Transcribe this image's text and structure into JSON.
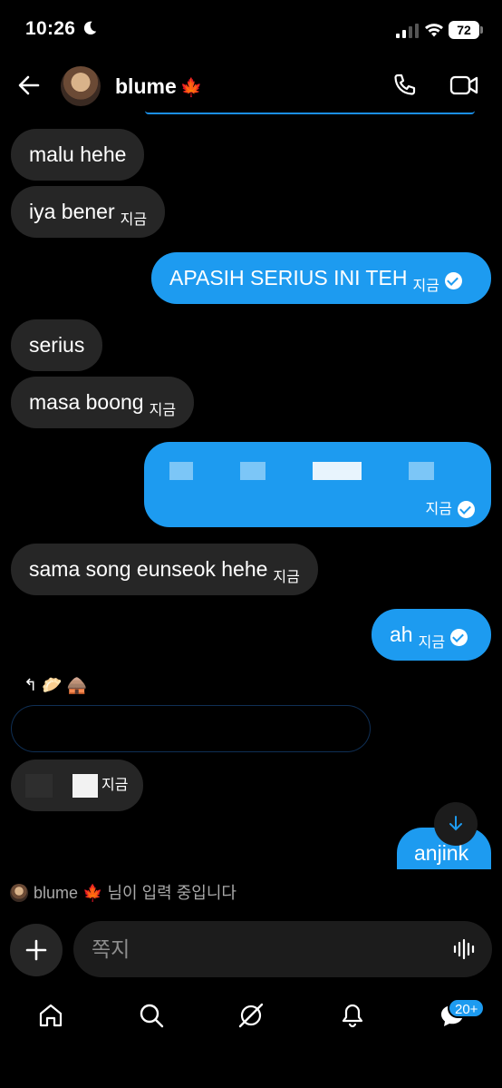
{
  "status": {
    "time": "10:26",
    "battery": "72"
  },
  "header": {
    "contact_name": "blume",
    "leaf": "🍁"
  },
  "messages": {
    "m1": "malu hehe",
    "m2": "iya bener",
    "m3": "APASIH SERIUS INI TEH",
    "m4": "serius",
    "m5": "masa boong",
    "m7": "sama song eunseok hehe",
    "m8": "ah",
    "m9": "anjink",
    "stamp": "지금"
  },
  "reply_reactions": "↰ 🥟 🛖",
  "typing": {
    "name": "blume",
    "leaf": "🍁",
    "text": "님이 입력 중입니다"
  },
  "composer": {
    "placeholder": "쪽지"
  },
  "nav": {
    "badge": "20+"
  },
  "colors": {
    "accent": "#1d9bf0",
    "incoming": "#262626",
    "background": "#000000"
  }
}
